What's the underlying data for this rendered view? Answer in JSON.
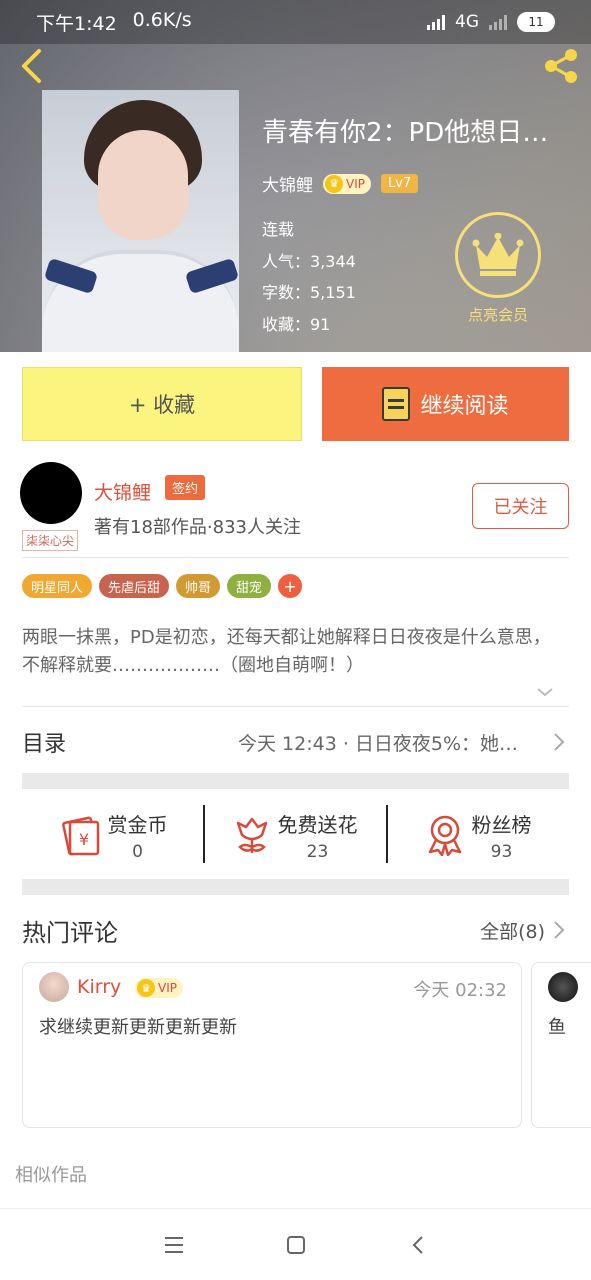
{
  "status_bar": {
    "time": "下午1:42",
    "speed": "0.6K/s",
    "network": "4G",
    "battery": "11"
  },
  "book": {
    "title": "青春有你2：PD他想日日…",
    "author": "大锦鲤",
    "vip_label": "VIP",
    "level": "Lv7",
    "status": "连载",
    "popularity": "人气：3,344",
    "word_count": "字数：5,151",
    "favorites": "收藏：91"
  },
  "member": {
    "label": "点亮会员"
  },
  "actions": {
    "favorite_label": "+ 收藏",
    "read_label": "继续阅读"
  },
  "author_card": {
    "name": "大锦鲤",
    "badge": "签约",
    "avatar_tag": "柒柒心尖",
    "meta": "著有18部作品·833人关注",
    "follow_label": "已关注"
  },
  "tags": [
    {
      "label": "明星同人",
      "color": "#f0a832"
    },
    {
      "label": "先虐后甜",
      "color": "#c8644e"
    },
    {
      "label": "帅哥",
      "color": "#d29a32"
    },
    {
      "label": "甜宠",
      "color": "#8db041"
    }
  ],
  "tag_add": "+",
  "description": "两眼一抹黑，PD是初恋，还每天都让她解释日日夜夜是什么意思，不解释就要………………（圈地自萌啊！）",
  "toc": {
    "title": "目录",
    "latest": "今天 12:43 · 日日夜夜5%：她…"
  },
  "stats": [
    {
      "label": "赏金币",
      "value": "0",
      "icon": "coin-envelope-icon"
    },
    {
      "label": "免费送花",
      "value": "23",
      "icon": "flower-icon"
    },
    {
      "label": "粉丝榜",
      "value": "93",
      "icon": "medal-icon"
    }
  ],
  "comments": {
    "title": "热门评论",
    "all_label": "全部(8)",
    "items": [
      {
        "user": "Kirry",
        "vip": "VIP",
        "time": "今天 02:32",
        "text": "求继续更新更新更新更新"
      },
      {
        "text": "鱼"
      }
    ]
  },
  "similar_label": "相似作品",
  "colors": {
    "accent_orange": "#ee6c3f",
    "favorite_yellow": "#fbf57f",
    "author_red": "#e04f3b",
    "member_gold": "#f6e07a"
  }
}
